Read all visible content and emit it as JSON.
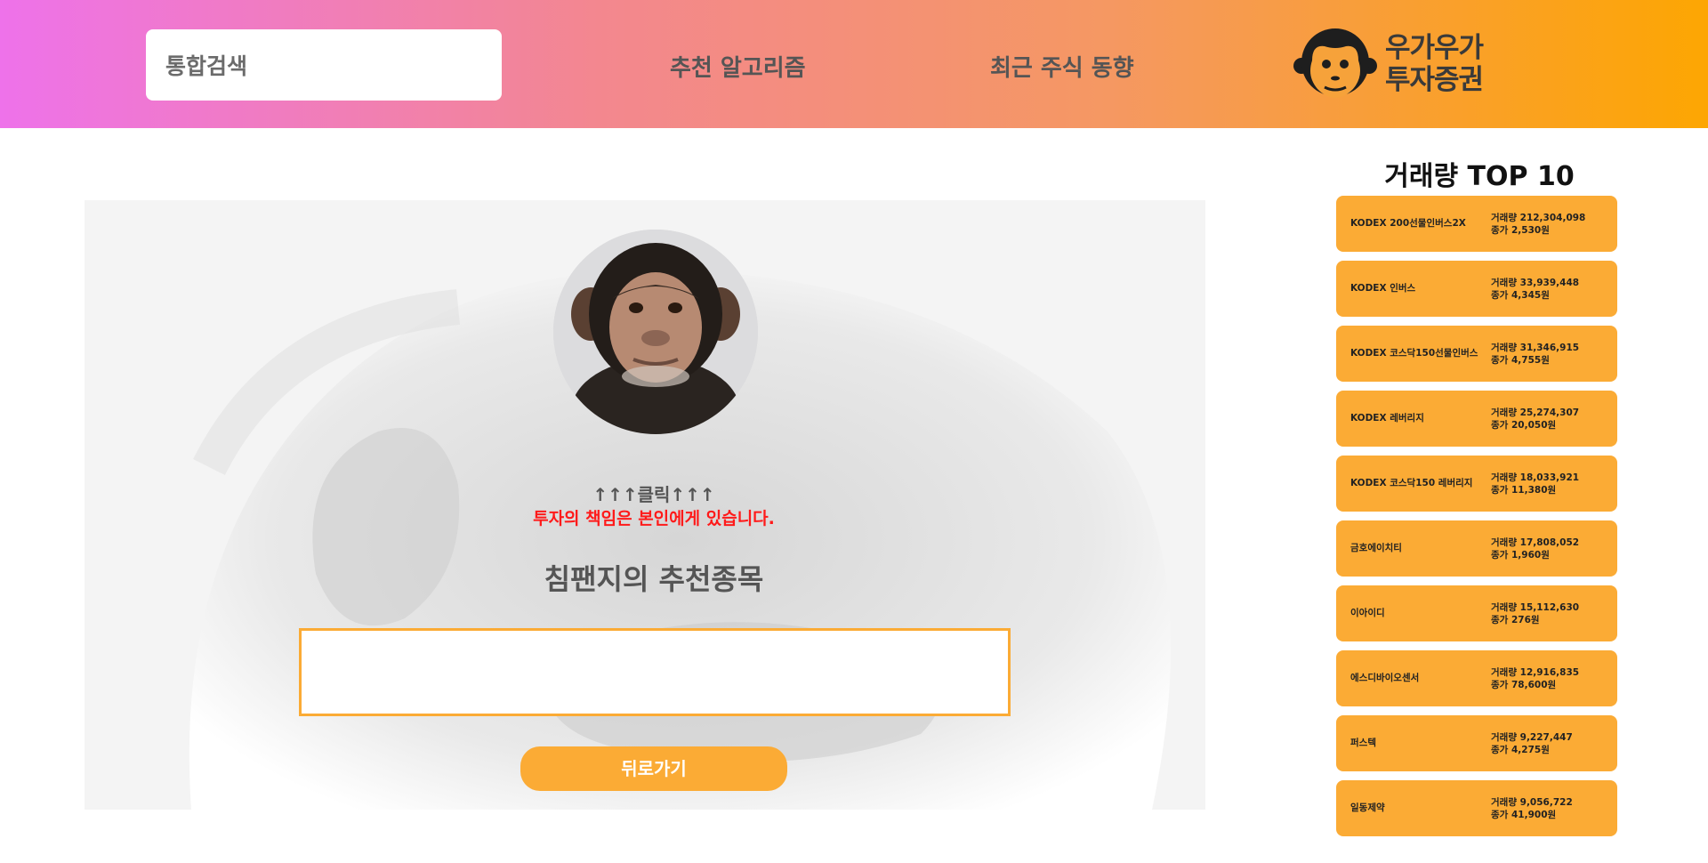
{
  "header": {
    "search": {
      "placeholder": "통합검색"
    },
    "nav": [
      {
        "label": "추천 알고리즘"
      },
      {
        "label": "최근 주식 동향"
      }
    ],
    "logo": {
      "line1": "우가우가",
      "line2": "투자증권"
    }
  },
  "main": {
    "click_hint": "↑↑↑클릭↑↑↑",
    "disclaimer": "투자의 책임은 본인에게 있습니다.",
    "reco_title": "침팬지의 추천종목",
    "reco_value": "",
    "back_label": "뒤로가기"
  },
  "sidebar": {
    "title": "거래량 TOP 10",
    "items": [
      {
        "name": "KODEX 200선물인버스2X",
        "volume": "거래량 212,304,098",
        "close": "종가 2,530원"
      },
      {
        "name": "KODEX 인버스",
        "volume": "거래량 33,939,448",
        "close": "종가 4,345원"
      },
      {
        "name": "KODEX 코스닥150선물인버스",
        "volume": "거래량 31,346,915",
        "close": "종가 4,755원"
      },
      {
        "name": "KODEX 레버리지",
        "volume": "거래량 25,274,307",
        "close": "종가 20,050원"
      },
      {
        "name": "KODEX 코스닥150 레버리지",
        "volume": "거래량 18,033,921",
        "close": "종가 11,380원"
      },
      {
        "name": "금호에이치티",
        "volume": "거래량 17,808,052",
        "close": "종가 1,960원"
      },
      {
        "name": "이아이디",
        "volume": "거래량 15,112,630",
        "close": "종가 276원"
      },
      {
        "name": "에스디바이오센서",
        "volume": "거래량 12,916,835",
        "close": "종가 78,600원"
      },
      {
        "name": "퍼스텍",
        "volume": "거래량 9,227,447",
        "close": "종가 4,275원"
      },
      {
        "name": "일동제약",
        "volume": "거래량 9,056,722",
        "close": "종가 41,900원"
      }
    ]
  },
  "colors": {
    "accent": "#fbab35",
    "warning": "#ff1a1a",
    "gradient_start": "#ee72ea",
    "gradient_end": "#fda602"
  }
}
